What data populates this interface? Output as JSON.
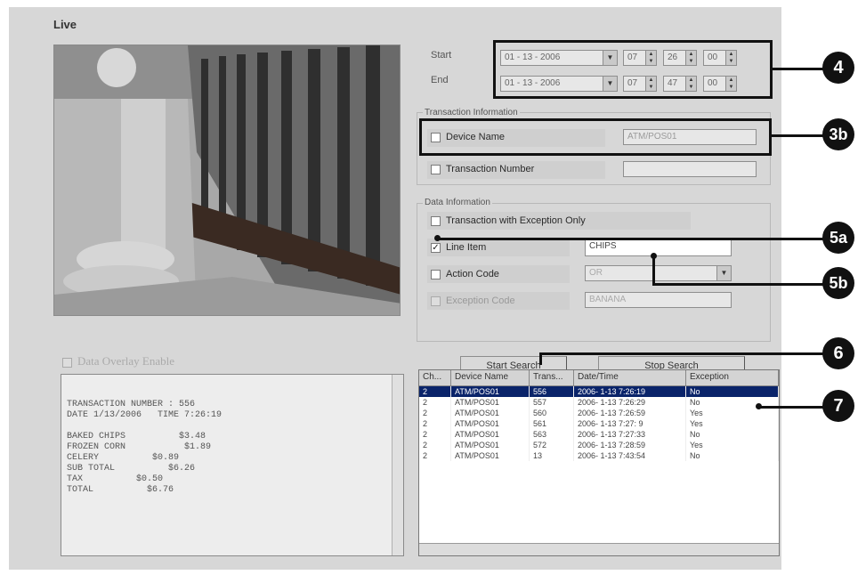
{
  "title": "Live",
  "time_range": {
    "start_label": "Start",
    "end_label": "End",
    "start_date": "01 - 13 - 2006",
    "start_hour": "07",
    "start_minute": "26",
    "start_second": "00",
    "end_date": "01 - 13 - 2006",
    "end_hour": "07",
    "end_minute": "47",
    "end_second": "00"
  },
  "transaction_info": {
    "group_title": "Transaction Information",
    "device_name_label": "Device Name",
    "device_name_value": "ATM/POS01",
    "transaction_number_label": "Transaction Number",
    "transaction_number_value": ""
  },
  "data_info": {
    "group_title": "Data Information",
    "exception_only_label": "Transaction with Exception Only",
    "line_item_label": "Line Item",
    "line_item_value": "CHIPS",
    "line_item_checked": true,
    "action_code_label": "Action Code",
    "action_code_value": "OR",
    "exception_code_label": "Exception Code",
    "exception_code_value": "BANANA"
  },
  "buttons": {
    "start_search": "Start Search",
    "stop_search": "Stop Search"
  },
  "overlay": {
    "label": "Data Overlay Enable",
    "text": "TRANSACTION NUMBER : 556\nDATE 1/13/2006   TIME 7:26:19\n\nBAKED CHIPS          $3.48\nFROZEN CORN           $1.89\nCELERY          $0.89\nSUB TOTAL          $6.26\nTAX          $0.50\nTOTAL          $6.76"
  },
  "results": {
    "columns": [
      "Ch...",
      "Device Name",
      "Trans...",
      "Date/Time",
      "Exception"
    ],
    "rows": [
      [
        "2",
        "ATM/POS01",
        "556",
        "2006- 1-13  7:26:19",
        "No"
      ],
      [
        "2",
        "ATM/POS01",
        "557",
        "2006- 1-13  7:26:29",
        "No"
      ],
      [
        "2",
        "ATM/POS01",
        "560",
        "2006- 1-13  7:26:59",
        "Yes"
      ],
      [
        "2",
        "ATM/POS01",
        "561",
        "2006- 1-13  7:27: 9",
        "Yes"
      ],
      [
        "2",
        "ATM/POS01",
        "563",
        "2006- 1-13  7:27:33",
        "No"
      ],
      [
        "2",
        "ATM/POS01",
        "572",
        "2006- 1-13  7:28:59",
        "Yes"
      ],
      [
        "2",
        "ATM/POS01",
        "13",
        "2006- 1-13  7:43:54",
        "No"
      ]
    ],
    "selected_index": 0
  },
  "callouts": [
    "4",
    "3b",
    "5a",
    "5b",
    "6",
    "7"
  ],
  "colors": {
    "panel": "#d7d7d7",
    "selection": "#0a246a",
    "callout": "#111111"
  }
}
